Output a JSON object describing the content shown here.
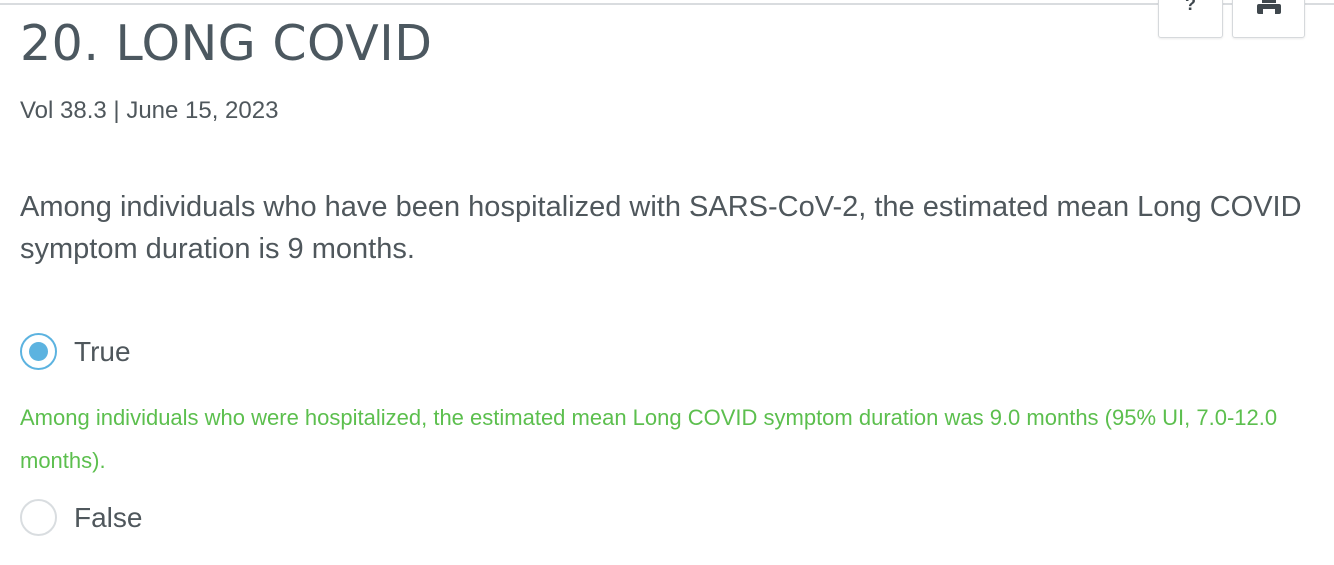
{
  "header": {
    "title": "20. LONG COVID",
    "meta": "Vol 38.3 | June 15, 2023"
  },
  "toolbar": {
    "help_glyph": "?",
    "help_icon": "question-mark-icon",
    "print_icon": "printer-icon"
  },
  "question": {
    "text": "Among individuals who have been hospitalized with SARS-CoV-2, the estimated mean Long COVID symptom duration is 9 months."
  },
  "options": [
    {
      "label": "True",
      "selected": true
    },
    {
      "label": "False",
      "selected": false
    }
  ],
  "feedback": {
    "text": "Among individuals who were hospitalized, the estimated mean Long COVID symptom duration was 9.0 months (95% UI, 7.0-12.0 months)."
  },
  "colors": {
    "title": "#4c5860",
    "body_text": "#4f575c",
    "radio_selected": "#5cb3e0",
    "feedback_correct": "#5cbf4e",
    "border": "#d6d9dc"
  }
}
